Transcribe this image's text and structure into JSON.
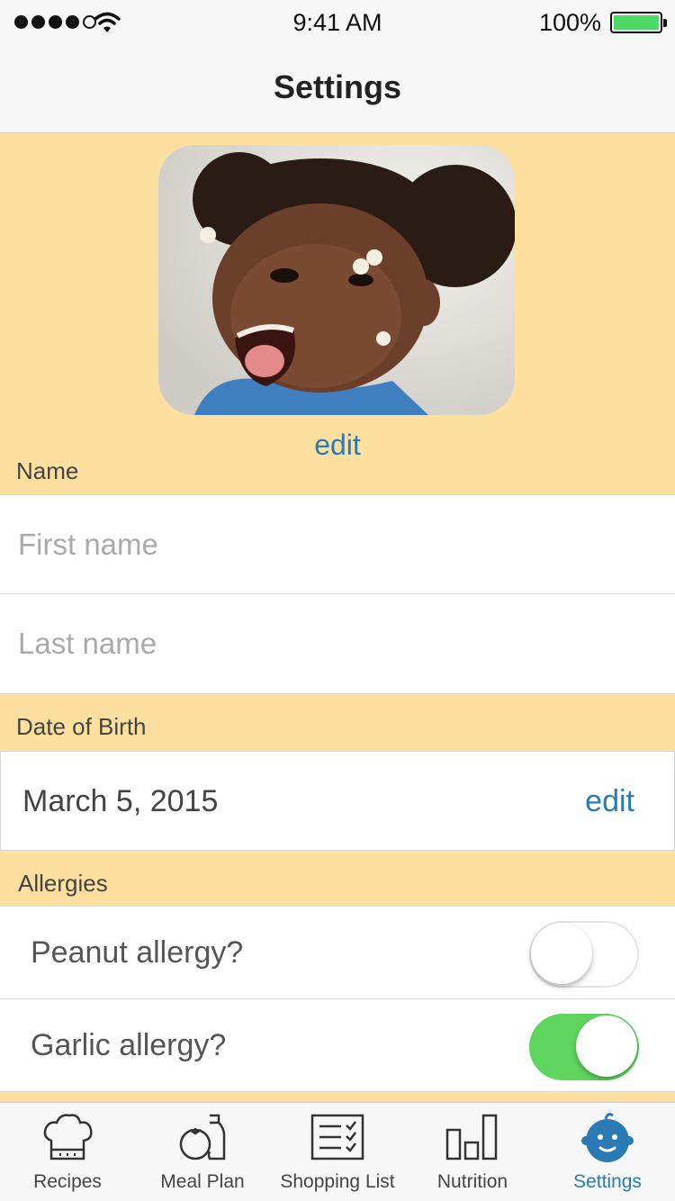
{
  "status_bar": {
    "time": "9:41 AM",
    "battery": "100%"
  },
  "nav": {
    "title": "Settings"
  },
  "profile": {
    "photo_edit": "edit"
  },
  "name_section": {
    "header": "Name",
    "first_placeholder": "First name",
    "last_placeholder": "Last name"
  },
  "dob_section": {
    "header": "Date of Birth",
    "value": "March 5, 2015",
    "edit": "edit"
  },
  "allergies_section": {
    "header": "Allergies",
    "items": [
      {
        "label": "Peanut allergy?",
        "enabled": false
      },
      {
        "label": "Garlic allergy?",
        "enabled": true
      }
    ]
  },
  "tabs": [
    {
      "label": "Recipes",
      "icon": "chef-hat-icon"
    },
    {
      "label": "Meal Plan",
      "icon": "tomato-bottle-icon"
    },
    {
      "label": "Shopping List",
      "icon": "checklist-icon"
    },
    {
      "label": "Nutrition",
      "icon": "bar-chart-icon"
    },
    {
      "label": "Settings",
      "icon": "baby-face-icon",
      "active": true
    }
  ],
  "colors": {
    "accent": "#2a7ab5",
    "section_bg": "#fde09f",
    "toggle_on": "#5fd55d"
  }
}
